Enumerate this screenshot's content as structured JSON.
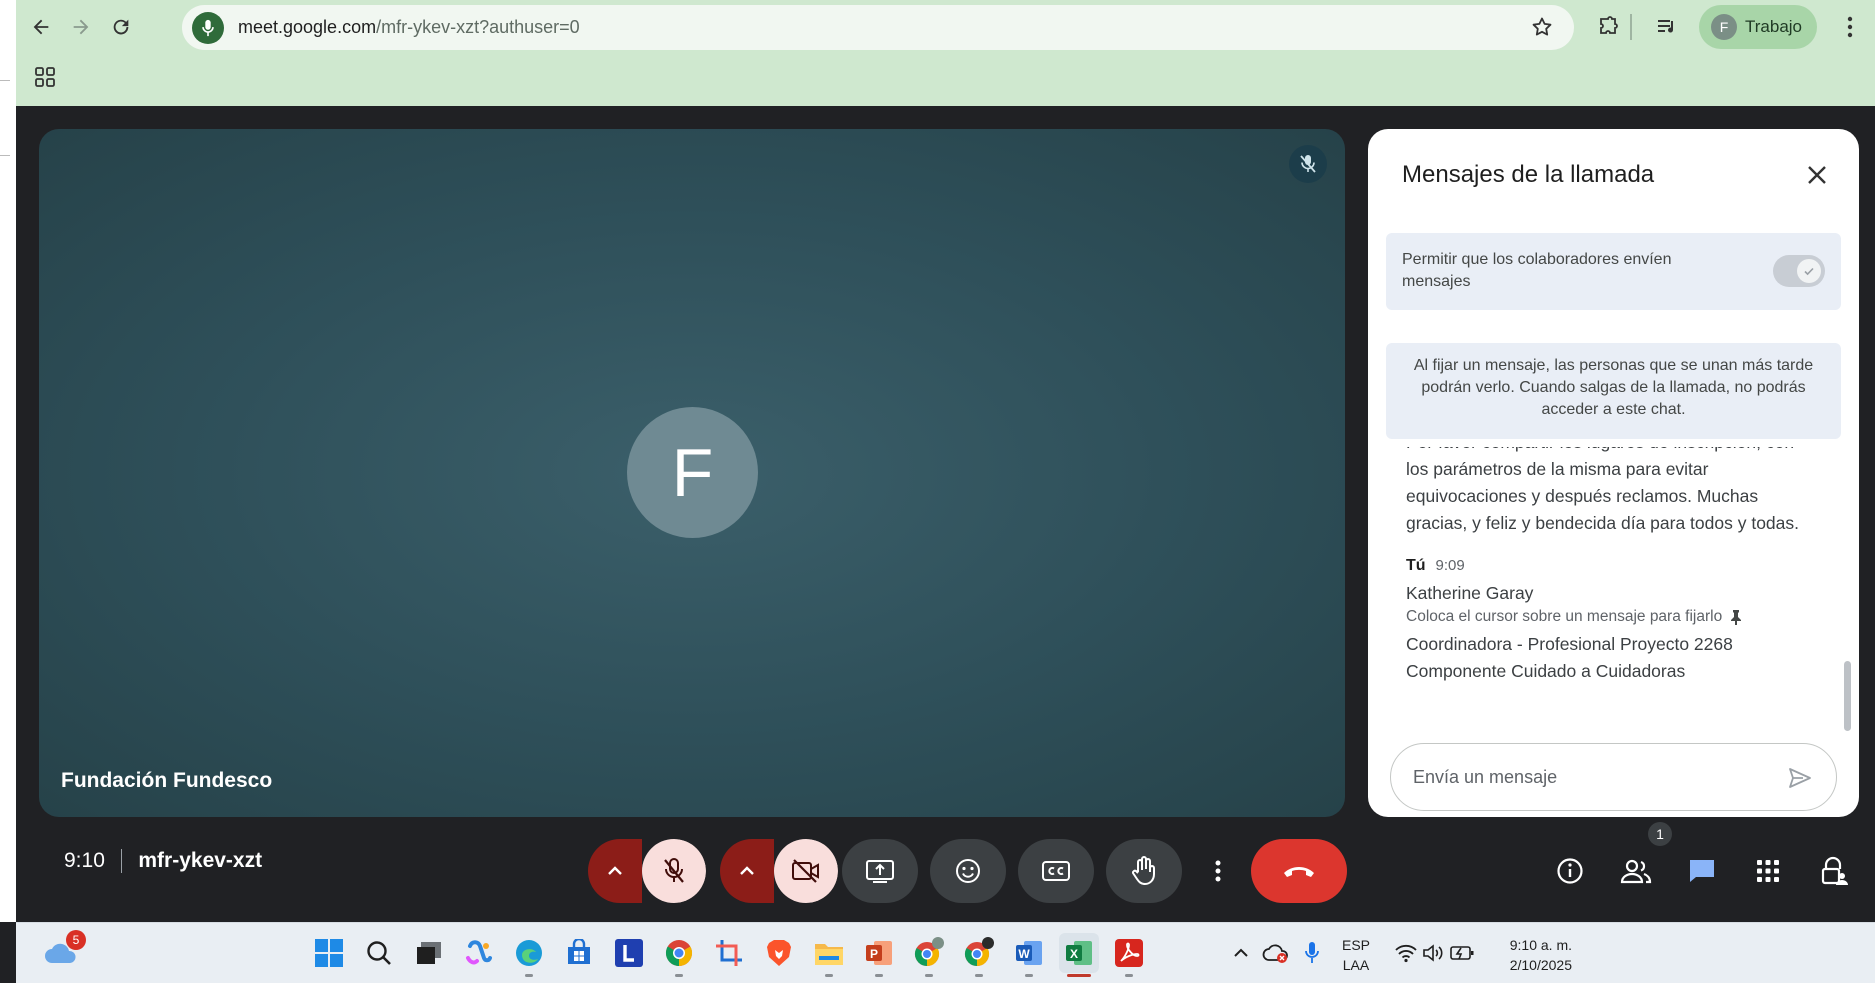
{
  "browser": {
    "url_host": "meet.google.com",
    "url_path": "/mfr-ykev-xzt?authuser=0",
    "profile_initial": "F",
    "profile_label": "Trabajo"
  },
  "tile": {
    "avatar_initial": "F",
    "participant_name": "Fundación Fundesco"
  },
  "chat": {
    "title": "Mensajes de la llamada",
    "permission_text": "Permitir que los colaboradores envíen mensajes",
    "permission_enabled": true,
    "info_text": "Al fijar un mensaje, las personas que se unan más tarde podrán verlo. Cuando salgas de la llamada, no podrás acceder a este chat.",
    "messages": [
      {
        "body": "Por favor compartir los lugares de inscripción, con los parámetros de la misma para evitar equivocaciones y después reclamos. Muchas gracias, y feliz y bendecida día para todos y todas."
      },
      {
        "sender": "Tú",
        "time": "9:09",
        "line1": "Katherine Garay",
        "hint": "Coloca el cursor sobre un mensaje para fijarlo",
        "body": "Coordinadora - Profesional Proyecto 2268 Componente Cuidado a Cuidadoras"
      }
    ],
    "compose_placeholder": "Envía un mensaje"
  },
  "meeting": {
    "time": "9:10",
    "code": "mfr-ykev-xzt",
    "participants_count": "1"
  },
  "taskbar": {
    "weather_badge": "5",
    "lang_line1": "ESP",
    "lang_line2": "LAA",
    "clock_time": "9:10 a. m.",
    "clock_date": "2/10/2025",
    "accent_active": "#c0392b"
  },
  "colors": {
    "chrome_bg": "#cfe8cf",
    "meet_bg": "#202124",
    "tile_bg": "#2e4f59",
    "mute_red": "#8c1d18",
    "mute_pink": "#f9dedc",
    "end_call": "#dc362e",
    "chat_accent": "#1a73e8"
  }
}
